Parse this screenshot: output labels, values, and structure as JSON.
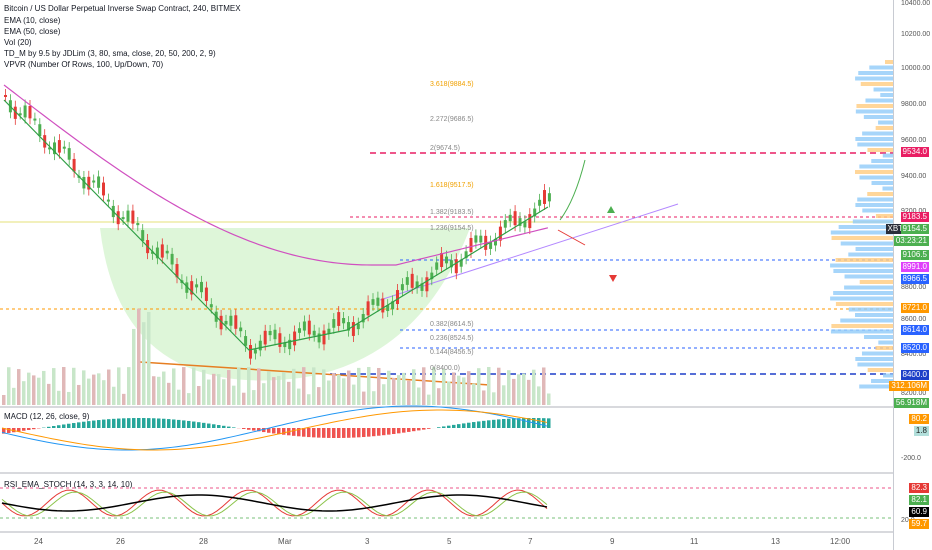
{
  "header": {
    "title": "Bitcoin / US Dollar Perpetual Inverse Swap Contract, 240, BITMEX",
    "indicators": [
      "EMA (10, close)",
      "EMA (50, close)",
      "Vol (20)",
      "TD_M by 9.5 by JDLim (3, 80, sma, close, 20, 50, 200, 2, 9)",
      "VPVR (Number Of Rows, 100, Up/Down, 70)"
    ]
  },
  "fib_labels": [
    "3.618(9884.5)",
    "2.272(9686.5)",
    "2(9674.5)",
    "1.618(9517.5)",
    "1.382(9183.5)",
    "1.236(9154.5)",
    "0.382(8614.5)",
    "0.236(8524.5)",
    "0.144(8456.5)",
    "0(8400.0)"
  ],
  "price_axis": [
    "10400.00",
    "10200.00",
    "10000.00",
    "9800.00",
    "9600.00",
    "9400.00",
    "9200.00",
    "8800.00",
    "8600.00",
    "8400.00",
    "8200.00"
  ],
  "price_tags": [
    {
      "text": "9534.0",
      "color": "#e91e63"
    },
    {
      "text": "9183.5",
      "color": "#e91e63"
    },
    {
      "text": "XBTUSD",
      "color": "#2a2e39"
    },
    {
      "text": "9154.5",
      "color": "#4caf50"
    },
    {
      "text": "03:23:21",
      "color": "#4caf50"
    },
    {
      "text": "9106.5",
      "color": "#4caf50"
    },
    {
      "text": "8991.0",
      "color": "#e040fb"
    },
    {
      "text": "8966.5",
      "color": "#2962ff"
    },
    {
      "text": "8721.0",
      "color": "#ff9800"
    },
    {
      "text": "8614.0",
      "color": "#2962ff"
    },
    {
      "text": "8520.0",
      "color": "#2962ff"
    },
    {
      "text": "8400.0",
      "color": "#1e3fc8"
    },
    {
      "text": "312.106M",
      "color": "#ff9800"
    },
    {
      "text": "56.918M",
      "color": "#4caf50"
    }
  ],
  "macd": {
    "label": "MACD (12, 26, close, 9)",
    "tags": [
      {
        "text": "80.2",
        "color": "#ff9800"
      },
      {
        "text": "1.8",
        "color": "#b2dfdb"
      }
    ],
    "axis": [
      "-200.0"
    ]
  },
  "rsi": {
    "label": "RSI_EMA_STOCH (14, 3, 3, 14, 10)",
    "tags": [
      {
        "text": "82.3",
        "color": "#e53935"
      },
      {
        "text": "82.1",
        "color": "#4caf50"
      },
      {
        "text": "60.9",
        "color": "#000000"
      },
      {
        "text": "59.7",
        "color": "#ff9800"
      }
    ],
    "axis": [
      "20.0"
    ]
  },
  "time_axis": [
    "24",
    "26",
    "28",
    "Mar",
    "3",
    "5",
    "7",
    "9",
    "11",
    "13",
    "12:00"
  ]
}
